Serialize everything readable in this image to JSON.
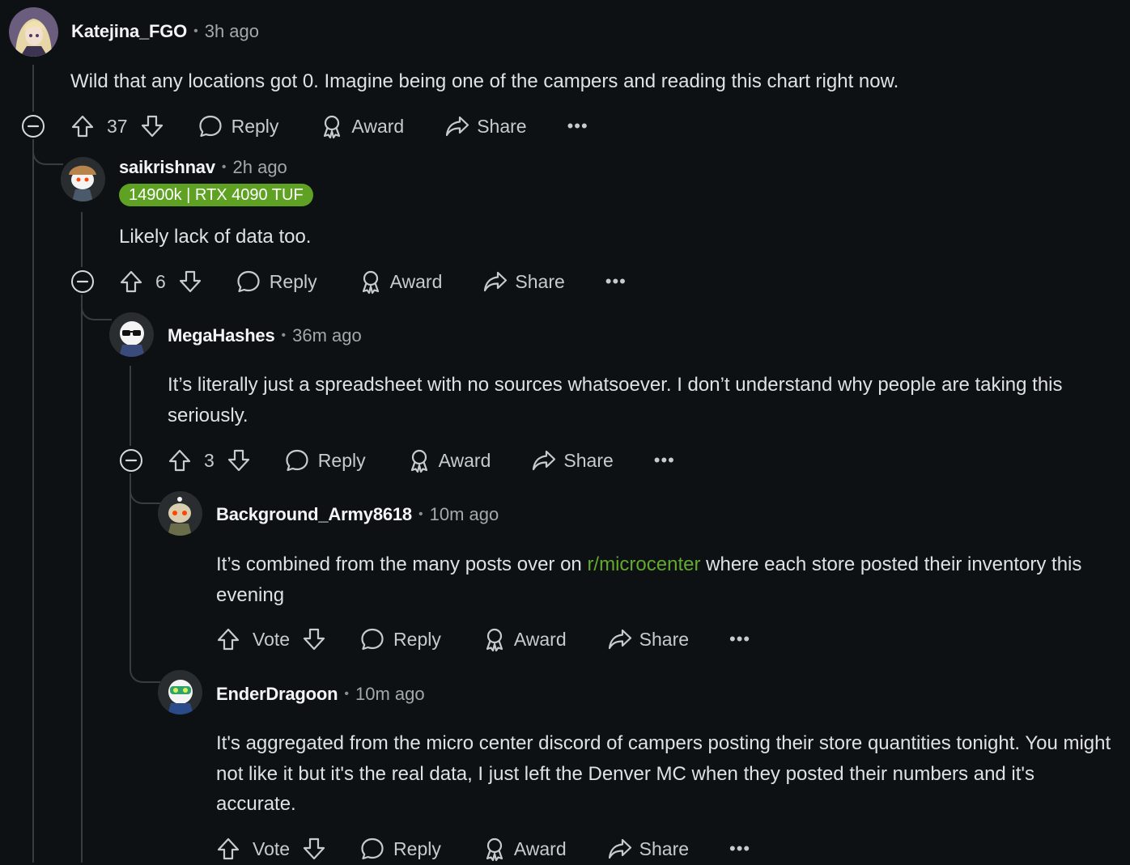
{
  "accent_color": "#62a92d",
  "labels": {
    "reply": "Reply",
    "award": "Award",
    "share": "Share",
    "more": "•••",
    "vote": "Vote",
    "separator": "•"
  },
  "comments": [
    {
      "author": "Katejina_FGO",
      "time": "3h ago",
      "body": "Wild that any locations got 0. Imagine being one of the campers and reading this chart right now.",
      "votes": "37",
      "avatar_icon": "anime-character-avatar"
    },
    {
      "author": "saikrishnav",
      "time": "2h ago",
      "flair": "14900k | RTX 4090 TUF",
      "flair_color": "#5fa223",
      "body": "Likely lack of data too.",
      "votes": "6",
      "avatar_icon": "snoo-hat-avatar"
    },
    {
      "author": "MegaHashes",
      "time": "36m ago",
      "body": "It’s literally just a spreadsheet with no sources whatsoever. I don’t understand why people are taking this seriously.",
      "votes": "3",
      "avatar_icon": "snoo-sunglasses-avatar"
    },
    {
      "author": "Background_Army8618",
      "time": "10m ago",
      "body_prefix": "It’s combined from the many posts over on ",
      "body_link": "r/microcenter",
      "body_suffix": " where each store posted their inventory this evening",
      "votes": "Vote",
      "avatar_icon": "snoo-default-avatar"
    },
    {
      "author": "EnderDragoon",
      "time": "10m ago",
      "body": "It's aggregated from the micro center discord of campers posting their store quantities tonight. You might not like it but it's the real data, I just left the Denver MC when they posted their numbers and it's accurate.",
      "votes": "Vote",
      "avatar_icon": "snoo-goggles-avatar"
    }
  ]
}
